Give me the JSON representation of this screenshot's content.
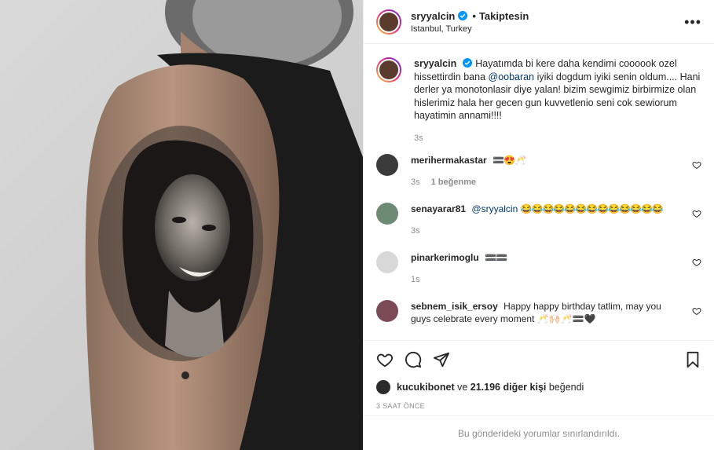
{
  "post": {
    "username": "sryyalcin",
    "follow_status": "Takiptesin",
    "dot": "•",
    "location": "Istanbul, Turkey",
    "more": "•••",
    "caption_text": "Hayatımda bi kere daha kendimi coooook ozel hissettirdin bana",
    "caption_mention": "@oobaran",
    "caption_text2": "iyiki dogdum iyiki senin oldum.... Hani derler ya monotonlasir diye yalan! bizim sewgimiz birbirmize olan hislerimiz hala her gecen gun kuvvetlenio seni cok sewiorum hayatimin annami!!!!",
    "caption_time": "3s"
  },
  "comments": [
    {
      "user": "merihermakastar",
      "text": "🟰😍🥂",
      "time": "3s",
      "likes": "1 beğenme"
    },
    {
      "user": "senayarar81",
      "mention": "@sryyalcin",
      "text": "😂😂😂😂😂😂😂😂😂😂😂😂😂",
      "time": "3s"
    },
    {
      "user": "pinarkerimoglu",
      "text": "🟰🟰",
      "time": "1s"
    },
    {
      "user": "sebnem_isik_ersoy",
      "text": "Happy happy birthday tatlim, may you guys celebrate every moment 🥂🙌🏻🥂🟰🖤",
      "time": ""
    }
  ],
  "footer": {
    "liked_by_user": "kucukibonet",
    "liked_mid": " ve ",
    "liked_count": "21.196 diğer kişi",
    "liked_end": " beğendi",
    "time_ago": "3 SAAT ÖNCE",
    "restricted": "Bu gönderideki yorumlar sınırlandırıldı."
  },
  "colors": {
    "accent": "#0095f6",
    "mention": "#00376b",
    "muted": "#8e8e8e",
    "text": "#262626"
  }
}
